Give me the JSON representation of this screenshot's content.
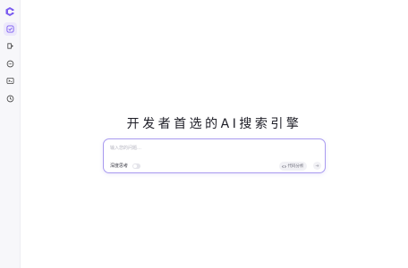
{
  "sidebar": {
    "logo_icon": "brand-logo-icon",
    "items": [
      {
        "icon": "chat-check-icon",
        "active": true
      },
      {
        "icon": "plugin-icon",
        "active": false
      },
      {
        "icon": "message-dots-icon",
        "active": false
      },
      {
        "icon": "terminal-icon",
        "active": false
      },
      {
        "icon": "history-clock-icon",
        "active": false
      }
    ]
  },
  "main": {
    "headline": "开发者首选的AI搜索引擎",
    "search": {
      "placeholder": "输入您的问题…",
      "deep_think_label": "深度思考",
      "deep_think_enabled": false,
      "code_analysis_label": "代码分析"
    }
  },
  "colors": {
    "accent": "#7b5cf0",
    "border": "#a99bf0",
    "active_bg": "#ece8fb"
  }
}
